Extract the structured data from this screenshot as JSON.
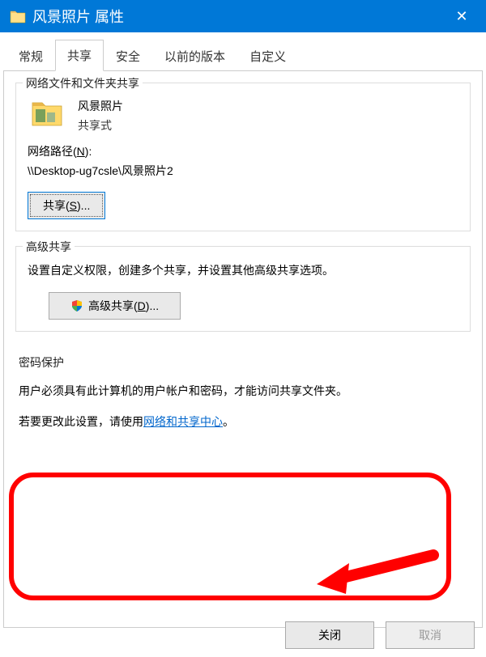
{
  "title": "风景照片 属性",
  "tabs": {
    "general": "常规",
    "sharing": "共享",
    "security": "安全",
    "previous": "以前的版本",
    "custom": "自定义"
  },
  "sharing_group": {
    "legend": "网络文件和文件夹共享",
    "folder_name": "风景照片",
    "share_state": "共享式",
    "path_label_pre": "网络路径(",
    "path_label_key": "N",
    "path_label_post": "):",
    "path_value": "\\\\Desktop-ug7csle\\风景照片2",
    "share_btn_pre": "共享(",
    "share_btn_key": "S",
    "share_btn_post": ")..."
  },
  "advanced_group": {
    "legend": "高级共享",
    "desc": "设置自定义权限，创建多个共享，并设置其他高级共享选项。",
    "btn_pre": "高级共享(",
    "btn_key": "D",
    "btn_post": ")..."
  },
  "password_group": {
    "legend": "密码保护",
    "line1": "用户必须具有此计算机的用户帐户和密码，才能访问共享文件夹。",
    "line2_pre": "若要更改此设置，请使用",
    "line2_link": "网络和共享中心",
    "line2_post": "。"
  },
  "buttons": {
    "close": "关闭",
    "cancel": "取消"
  }
}
